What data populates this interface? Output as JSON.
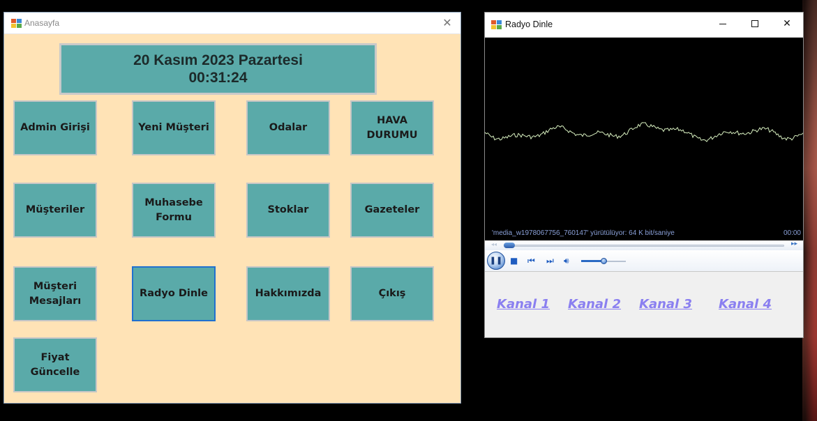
{
  "main_window": {
    "title": "Anasayfa",
    "date_line": "20 Kasım 2023 Pazartesi",
    "time_line": "00:31:24",
    "buttons": [
      "Admin Girişi",
      "Yeni Müşteri",
      "Odalar",
      "HAVA DURUMU",
      "Müşteriler",
      "Muhasebe Formu",
      "Stoklar",
      "Gazeteler",
      "Müşteri Mesajları",
      "Radyo Dinle",
      "Hakkımızda",
      "Çıkış",
      "Fiyat Güncelle"
    ]
  },
  "radio_window": {
    "title": "Radyo Dinle",
    "status": "'media_w1978067756_760147' yürütülüyor: 64 K bit/saniye",
    "time": "00:00",
    "channels": [
      "Kanal 1",
      "Kanal 2",
      "Kanal 3",
      "Kanal 4"
    ]
  },
  "icons": {
    "close": "close-icon",
    "minimize": "minimize-icon",
    "maximize": "maximize-icon",
    "pause": "pause-icon",
    "stop": "stop-icon",
    "previous": "previous-icon",
    "next": "next-icon",
    "volume": "volume-icon"
  },
  "colors": {
    "form_bg": "#ffe3b6",
    "tile": "#5aaaa9",
    "focus": "#2070d0",
    "link": "#8a7ff0"
  }
}
